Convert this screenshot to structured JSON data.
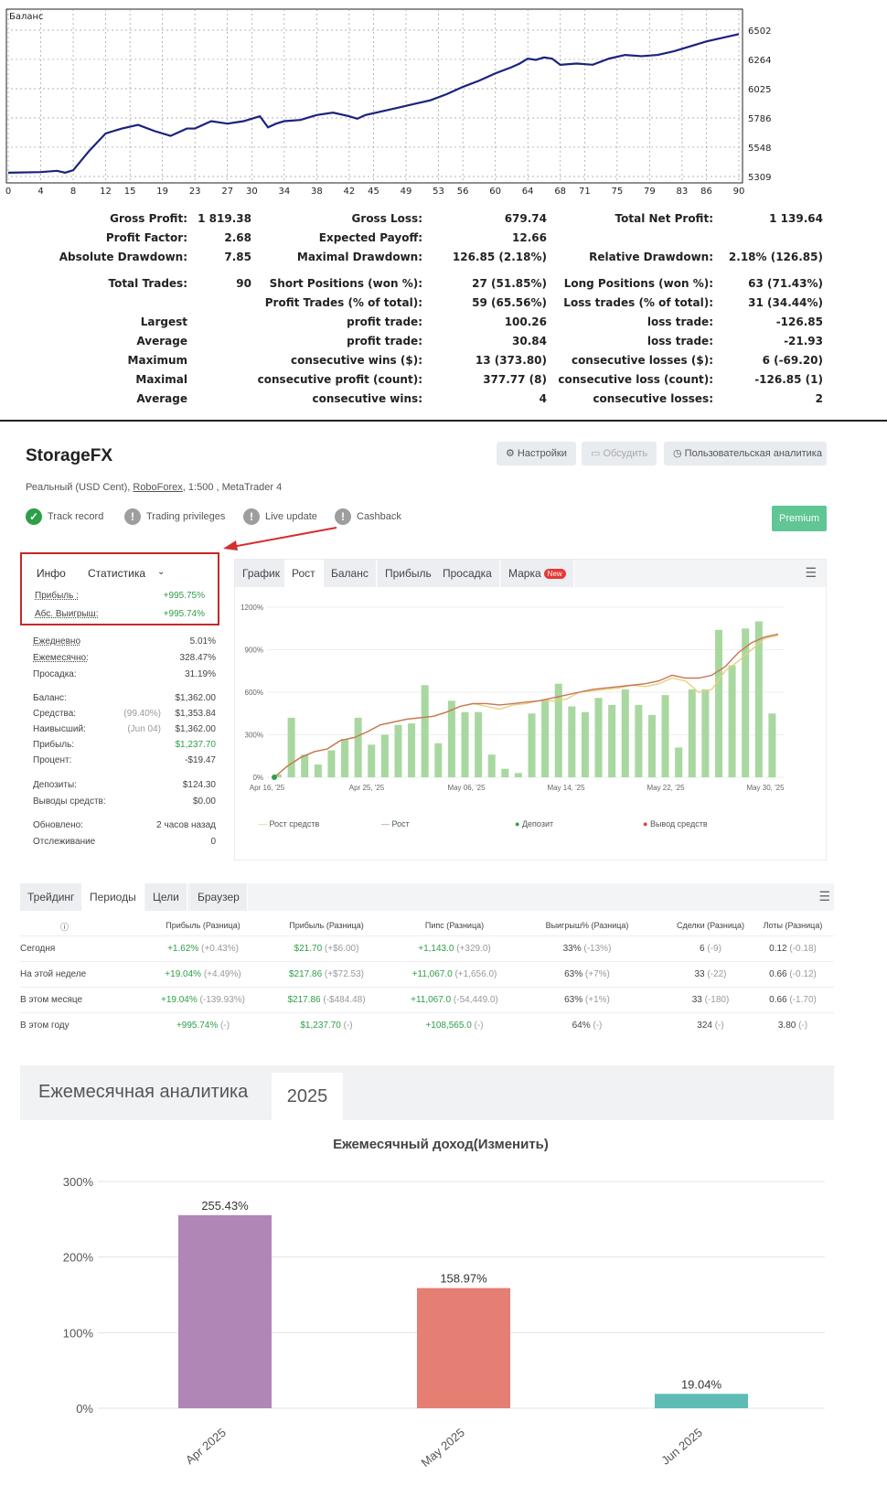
{
  "balance_chart": {
    "label": "Баланс",
    "y_ticks": [
      "6502",
      "6264",
      "6025",
      "5786",
      "5548",
      "5309"
    ],
    "x_ticks": [
      "0",
      "4",
      "8",
      "12",
      "15",
      "19",
      "23",
      "27",
      "30",
      "34",
      "38",
      "42",
      "45",
      "49",
      "53",
      "56",
      "60",
      "64",
      "68",
      "71",
      "75",
      "79",
      "83",
      "86",
      "90"
    ]
  },
  "chart_data": [
    {
      "type": "line",
      "title": "",
      "ylim": [
        5309,
        6502
      ],
      "xlim": [
        0,
        90
      ],
      "series": [
        {
          "name": "Баланс",
          "x": [
            0,
            4,
            6,
            7,
            8,
            10,
            12,
            14,
            16,
            18,
            20,
            22,
            23,
            25,
            27,
            29,
            30,
            31,
            32,
            33,
            34,
            36,
            37,
            38,
            40,
            42,
            43,
            44,
            46,
            48,
            50,
            52,
            54,
            56,
            58,
            60,
            62,
            63,
            64,
            65,
            66,
            67,
            68,
            70,
            72,
            74,
            76,
            78,
            80,
            82,
            84,
            86,
            88,
            90
          ],
          "y": [
            5340,
            5345,
            5355,
            5340,
            5360,
            5520,
            5660,
            5700,
            5730,
            5680,
            5640,
            5700,
            5700,
            5760,
            5740,
            5760,
            5780,
            5800,
            5710,
            5740,
            5760,
            5770,
            5790,
            5810,
            5830,
            5800,
            5780,
            5810,
            5840,
            5870,
            5900,
            5930,
            5980,
            6040,
            6090,
            6150,
            6200,
            6230,
            6270,
            6260,
            6280,
            6270,
            6220,
            6230,
            6220,
            6270,
            6300,
            6290,
            6300,
            6330,
            6370,
            6410,
            6440,
            6470
          ]
        }
      ]
    },
    {
      "type": "bar",
      "title": "",
      "ylim": [
        0,
        1200
      ],
      "y_ticks": [
        "0%",
        "300%",
        "600%",
        "900%",
        "1200%"
      ],
      "x_ticks": [
        "Apr 16, '25",
        "Apr 25, '25",
        "May 06, '25",
        "May 14, '25",
        "May 22, '25",
        "May 30, '25"
      ],
      "bars": [
        20,
        420,
        160,
        90,
        190,
        270,
        420,
        230,
        300,
        370,
        380,
        650,
        240,
        540,
        460,
        460,
        160,
        60,
        30,
        450,
        550,
        660,
        500,
        460,
        560,
        510,
        620,
        510,
        440,
        580,
        210,
        620,
        620,
        1040,
        790,
        1050,
        1100,
        450
      ],
      "series": [
        {
          "name": "Рост средств",
          "values": [
            0,
            80,
            140,
            180,
            200,
            260,
            280,
            320,
            370,
            390,
            410,
            420,
            430,
            460,
            500,
            520,
            500,
            480,
            510,
            520,
            540,
            540,
            550,
            600,
            610,
            620,
            630,
            650,
            640,
            660,
            700,
            680,
            600,
            620,
            750,
            820,
            900,
            980,
            1000
          ]
        },
        {
          "name": "Рост",
          "values": [
            0,
            80,
            140,
            180,
            200,
            260,
            280,
            320,
            370,
            390,
            410,
            420,
            430,
            460,
            500,
            520,
            520,
            510,
            520,
            530,
            540,
            560,
            580,
            600,
            620,
            630,
            640,
            650,
            660,
            680,
            720,
            700,
            700,
            720,
            780,
            880,
            950,
            990,
            1010
          ]
        }
      ],
      "legend": [
        "Рост средств",
        "Рост",
        "Депозит",
        "Вывод средств"
      ]
    },
    {
      "type": "bar",
      "title": "Ежемесячный доход(Изменить)",
      "categories": [
        "Apr 2025",
        "May 2025",
        "Jun 2025"
      ],
      "values": [
        255.43,
        158.97,
        19.04
      ],
      "value_labels": [
        "255.43%",
        "158.97%",
        "19.04%"
      ],
      "colors": [
        "#b086b6",
        "#e57e73",
        "#5dbcb4"
      ],
      "ylim": [
        0,
        300
      ],
      "y_ticks": [
        "300%",
        "200%",
        "100%",
        "0%"
      ]
    }
  ],
  "report": {
    "rows": [
      [
        [
          "Gross Profit:",
          "1 819.38"
        ],
        [
          "Gross Loss:",
          "679.74"
        ],
        [
          "Total Net Profit:",
          "1 139.64"
        ]
      ],
      [
        [
          "Profit Factor:",
          "2.68"
        ],
        [
          "Expected Payoff:",
          "12.66"
        ],
        [
          "",
          ""
        ]
      ],
      [
        [
          "Absolute Drawdown:",
          "7.85"
        ],
        [
          "Maximal Drawdown:",
          "126.85 (2.18%)"
        ],
        [
          "Relative Drawdown:",
          "2.18% (126.85)"
        ]
      ],
      [
        [
          "Total Trades:",
          "90"
        ],
        [
          "Short Positions (won %):",
          "27 (51.85%)"
        ],
        [
          "Long Positions (won %):",
          "63 (71.43%)"
        ]
      ],
      [
        [
          "",
          ""
        ],
        [
          "Profit Trades (% of total):",
          "59 (65.56%)"
        ],
        [
          "Loss trades (% of total):",
          "31 (34.44%)"
        ]
      ],
      [
        [
          "Largest",
          ""
        ],
        [
          "profit trade:",
          "100.26"
        ],
        [
          "loss trade:",
          "-126.85"
        ]
      ],
      [
        [
          "Average",
          ""
        ],
        [
          "profit trade:",
          "30.84"
        ],
        [
          "loss trade:",
          "-21.93"
        ]
      ],
      [
        [
          "Maximum",
          ""
        ],
        [
          "consecutive wins ($):",
          "13 (373.80)"
        ],
        [
          "consecutive losses ($):",
          "6 (-69.20)"
        ]
      ],
      [
        [
          "Maximal",
          ""
        ],
        [
          "consecutive profit (count):",
          "377.77 (8)"
        ],
        [
          "consecutive loss (count):",
          "-126.85 (1)"
        ]
      ],
      [
        [
          "Average",
          ""
        ],
        [
          "consecutive wins:",
          "4"
        ],
        [
          "consecutive losses:",
          "2"
        ]
      ]
    ]
  },
  "app": {
    "title": "StorageFX",
    "buttons": {
      "settings": "Настройки",
      "discuss": "Обсудить",
      "analytics": "Пользовательская аналитика"
    },
    "subtitle_prefix": "Реальный (USD Cent), ",
    "broker": "RoboForex",
    "subtitle_suffix": ", 1:500 , MetaTrader 4",
    "badges": [
      "Track record",
      "Trading privileges",
      "Live update",
      "Cashback"
    ],
    "premium": "Premium"
  },
  "left_panel": {
    "tabs": [
      "Инфо",
      "Статистика"
    ],
    "highlight": [
      [
        "Прибыль :",
        "+995.75%"
      ],
      [
        "Абс. Выигрыш:",
        "+995.74%"
      ]
    ],
    "rows1": [
      [
        "Ежедневно",
        "5.01%"
      ],
      [
        "Ежемесячно:",
        "328.47%"
      ],
      [
        "Просадка:",
        "31.19%"
      ]
    ],
    "rows2": [
      [
        "Баланс:",
        "",
        "$1,362.00"
      ],
      [
        "Средства:",
        "(99.40%)",
        "$1,353.84"
      ],
      [
        "Наивысший:",
        "(Jun 04)",
        "$1,362.00"
      ],
      [
        "Прибыль:",
        "",
        "$1,237.70"
      ],
      [
        "Процент:",
        "",
        "-$19.47"
      ]
    ],
    "rows3": [
      [
        "Депозиты:",
        "$124.30"
      ],
      [
        "Выводы средств:",
        "$0.00"
      ]
    ],
    "rows4": [
      [
        "Обновлено:",
        "2 часов назад"
      ],
      [
        "Отслеживание",
        "0"
      ]
    ]
  },
  "right_panel": {
    "tabs": [
      "График",
      "Рост",
      "Баланс",
      "Прибыль",
      "Просадка",
      "Марка"
    ],
    "new_badge": "New"
  },
  "periods": {
    "tabs": [
      "Трейдинг",
      "Периоды",
      "Цели",
      "Браузер"
    ],
    "headers": [
      "",
      "Прибыль (Разница)",
      "Прибыль (Разница)",
      "Пипс (Разница)",
      "Выигрыш% (Разница)",
      "Сделки (Разница)",
      "Лоты (Разница)"
    ],
    "rows": [
      [
        "Сегодня",
        "+1.62%",
        "(+0.43%)",
        "$21.70",
        "(+$6.00)",
        "+1,143.0",
        "(+329.0)",
        "33%",
        "(-13%)",
        "6",
        "(-9)",
        "0.12",
        "(-0.18)"
      ],
      [
        "На этой неделе",
        "+19.04%",
        "(+4.49%)",
        "$217.86",
        "(+$72.53)",
        "+11,067.0",
        "(+1,656.0)",
        "63%",
        "(+7%)",
        "33",
        "(-22)",
        "0.66",
        "(-0.12)"
      ],
      [
        "В этом месяце",
        "+19.04%",
        "(-139.93%)",
        "$217.86",
        "(-$484.48)",
        "+11,067.0",
        "(-54,449.0)",
        "63%",
        "(+1%)",
        "33",
        "(-180)",
        "0.66",
        "(-1.70)"
      ],
      [
        "В этом году",
        "+995.74%",
        "(-)",
        "$1,237.70",
        "(-)",
        "+108,565.0",
        "(-)",
        "64%",
        "(-)",
        "324",
        "(-)",
        "3.80",
        "(-)"
      ]
    ]
  },
  "monthly": {
    "title": "Ежемесячная аналитика",
    "year": "2025"
  }
}
